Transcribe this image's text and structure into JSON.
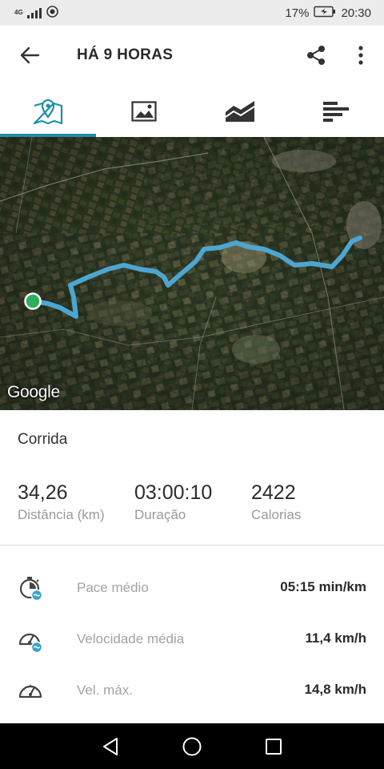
{
  "status_bar": {
    "network": "4G",
    "battery": "17%",
    "time": "20:30"
  },
  "header": {
    "title": "HÁ 9 HORAS"
  },
  "tabs": [
    {
      "name": "map-tab",
      "icon": "map-pin-icon",
      "active": true
    },
    {
      "name": "photos-tab",
      "icon": "image-icon",
      "active": false
    },
    {
      "name": "charts-tab",
      "icon": "area-chart-icon",
      "active": false
    },
    {
      "name": "splits-tab",
      "icon": "bars-icon",
      "active": false
    }
  ],
  "map": {
    "attribution": "Google",
    "route_color": "#4da6d1",
    "start_marker_color": "#2eaf5e"
  },
  "activity": {
    "type": "Corrida",
    "stats": [
      {
        "value": "34,26",
        "label": "Distância (km)"
      },
      {
        "value": "03:00:10",
        "label": "Duração"
      },
      {
        "value": "2422",
        "label": "Calorias"
      }
    ],
    "metrics": [
      {
        "label": "Pace médio",
        "value": "05:15 min/km",
        "icon": "stopwatch-icon"
      },
      {
        "label": "Velocidade média",
        "value": "11,4 km/h",
        "icon": "speedometer-avg-icon"
      },
      {
        "label": "Vel. máx.",
        "value": "14,8 km/h",
        "icon": "speedometer-icon"
      }
    ]
  },
  "colors": {
    "accent": "#1f8fa8"
  }
}
